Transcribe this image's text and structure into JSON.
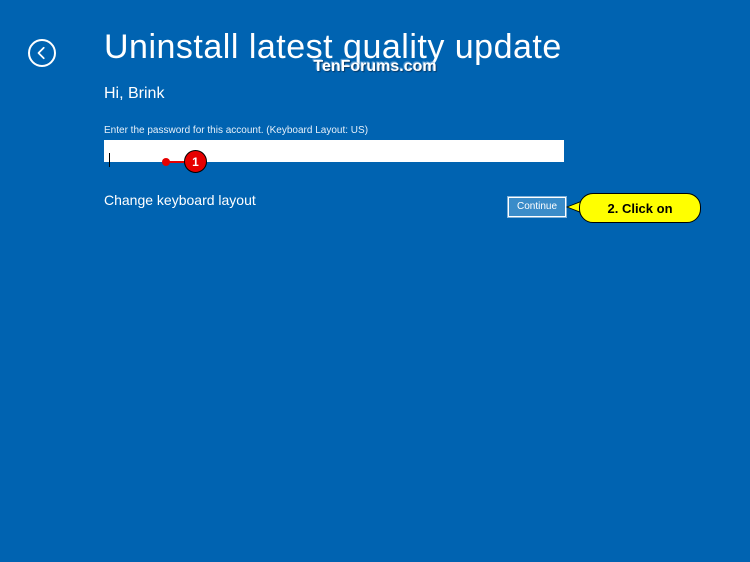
{
  "header": {
    "title": "Uninstall latest quality update"
  },
  "content": {
    "greeting": "Hi, Brink",
    "instruction": "Enter the password for this account. (Keyboard Layout: US)",
    "password_value": "",
    "change_layout_label": "Change keyboard layout"
  },
  "buttons": {
    "continue": "Continue"
  },
  "watermark": "TenForums.com",
  "annotations": {
    "step1": "1",
    "step2": "2. Click on"
  }
}
